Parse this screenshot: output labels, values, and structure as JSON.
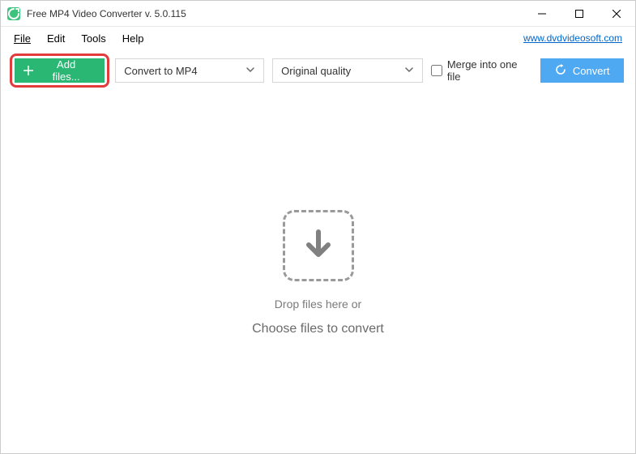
{
  "titlebar": {
    "title": "Free MP4 Video Converter v. 5.0.115"
  },
  "menu": {
    "file": "File",
    "edit": "Edit",
    "tools": "Tools",
    "help": "Help",
    "website_link": "www.dvdvideosoft.com"
  },
  "toolbar": {
    "add_files_label": "Add files...",
    "format_selected": "Convert to MP4",
    "quality_selected": "Original quality",
    "merge_label": "Merge into one file",
    "merge_checked": false,
    "convert_label": "Convert"
  },
  "drop": {
    "line1": "Drop files here or",
    "line2": "Choose files to convert"
  }
}
